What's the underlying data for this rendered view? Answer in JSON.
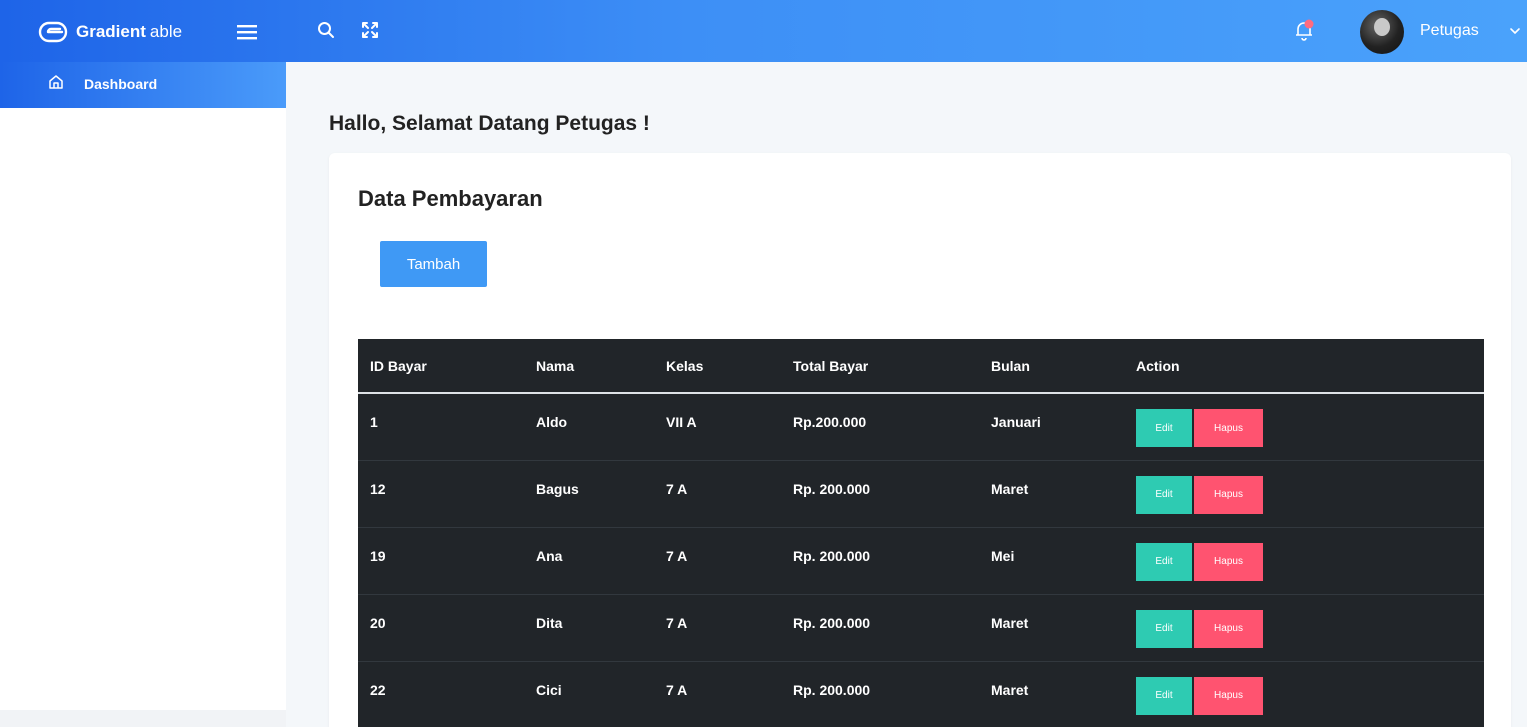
{
  "header": {
    "brand_bold": "Gradient",
    "brand_light": "able",
    "user_name": "Petugas",
    "icons": [
      "logo-icon",
      "hamburger-icon",
      "search-icon",
      "fullscreen-icon",
      "bell-icon",
      "chevron-down-icon"
    ],
    "colors": {
      "topbar_start": "#1e64e8",
      "topbar_end": "#4aa2fb",
      "notification_dot": "#ff6b7f"
    }
  },
  "sidebar": {
    "items": [
      {
        "label": "Dashboard",
        "icon": "home-icon",
        "active": true
      }
    ]
  },
  "main": {
    "welcome": "Hallo, Selamat Datang Petugas !",
    "card_title": "Data Pembayaran",
    "add_button": "Tambah",
    "table": {
      "headers": [
        "ID Bayar",
        "Nama",
        "Kelas",
        "Total Bayar",
        "Bulan",
        "Action"
      ],
      "rows": [
        {
          "id": "1",
          "nama": "Aldo",
          "kelas": "VII A",
          "total": "Rp.200.000",
          "bulan": "Januari"
        },
        {
          "id": "12",
          "nama": "Bagus",
          "kelas": "7 A",
          "total": "Rp. 200.000",
          "bulan": "Maret"
        },
        {
          "id": "19",
          "nama": "Ana",
          "kelas": "7 A",
          "total": "Rp. 200.000",
          "bulan": "Mei"
        },
        {
          "id": "20",
          "nama": "Dita",
          "kelas": "7 A",
          "total": "Rp. 200.000",
          "bulan": "Maret"
        },
        {
          "id": "22",
          "nama": "Cici",
          "kelas": "7 A",
          "total": "Rp. 200.000",
          "bulan": "Maret"
        }
      ],
      "edit_label": "Edit",
      "delete_label": "Hapus",
      "colors": {
        "table_bg": "#212529",
        "edit": "#2ecbb2",
        "delete": "#ff5370",
        "add": "#3f99f5"
      }
    }
  }
}
